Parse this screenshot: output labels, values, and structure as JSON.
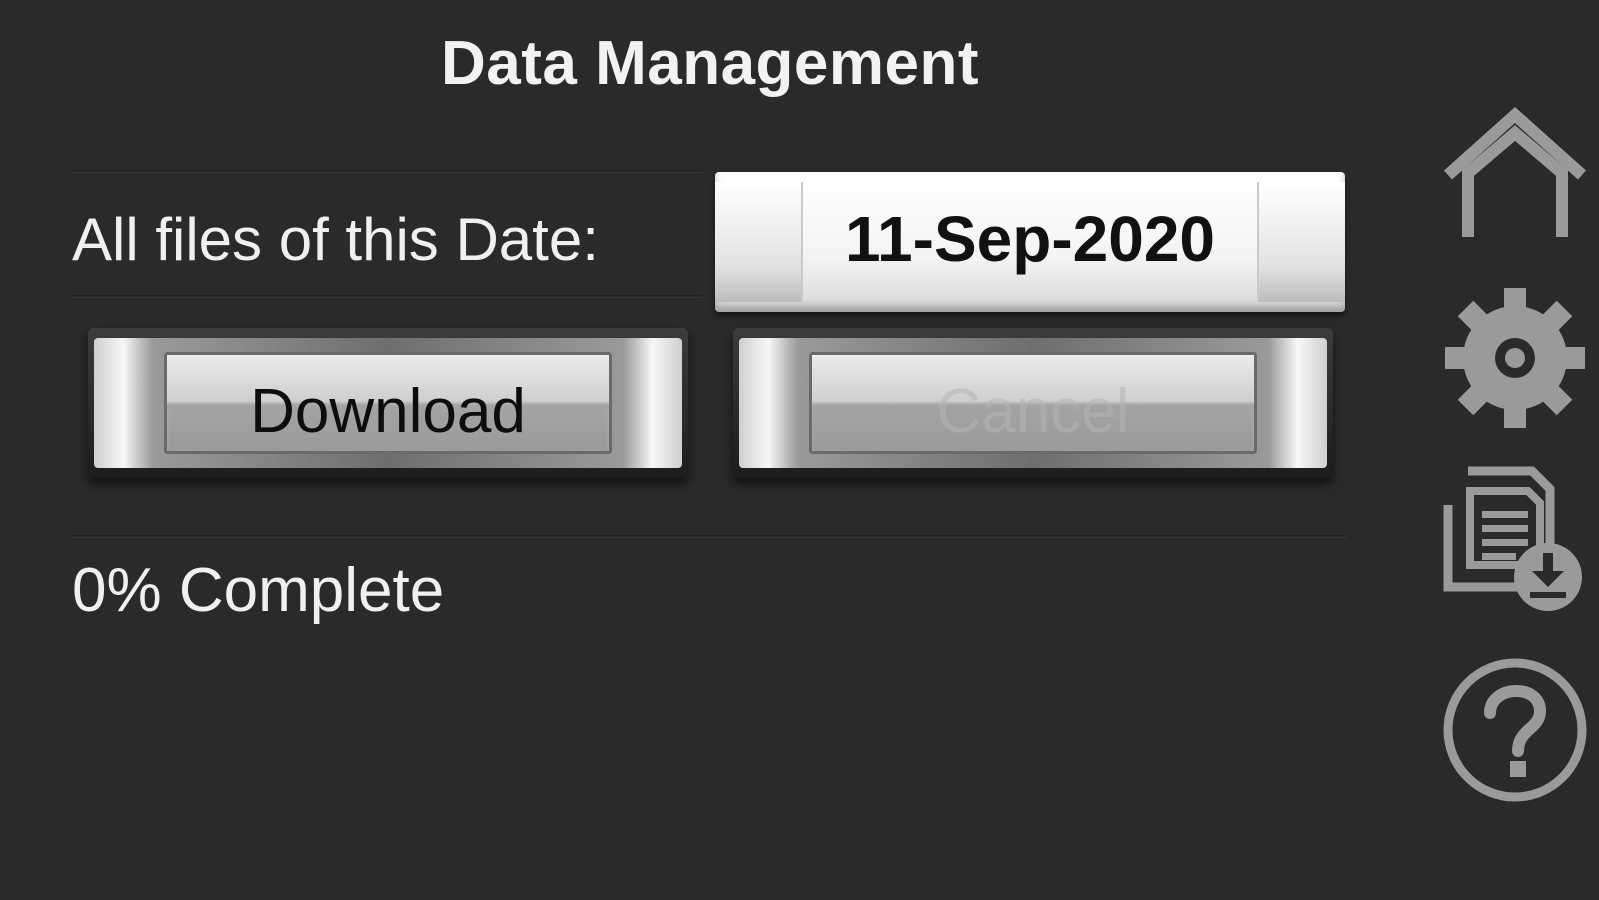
{
  "header": {
    "title": "Data Management"
  },
  "date_row": {
    "label": "All files of this Date:",
    "date_value": "11-Sep-2020"
  },
  "actions": {
    "download_label": "Download",
    "cancel_label": "Cancel",
    "cancel_enabled": false
  },
  "progress": {
    "percent": 0,
    "text": "0% Complete"
  },
  "sidebar": {
    "icons": [
      "home-icon",
      "gear-icon",
      "file-download-icon",
      "help-icon"
    ]
  },
  "colors": {
    "background": "#2a2a2a",
    "text": "#f0f0f0",
    "icon": "#9a9a9a"
  }
}
